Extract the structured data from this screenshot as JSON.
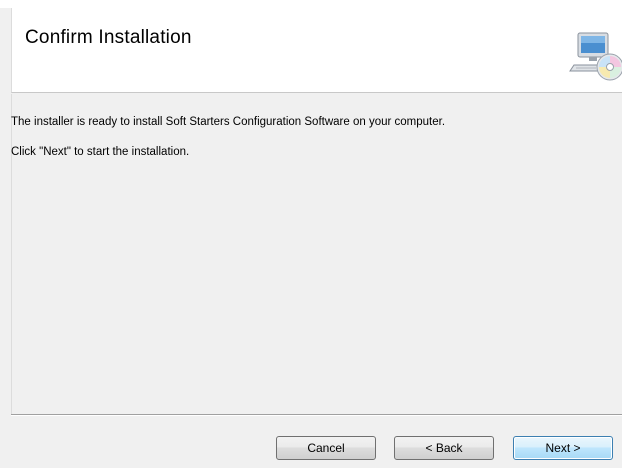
{
  "dialog": {
    "title": "Confirm Installation",
    "icon": "computer-cd-install-icon"
  },
  "content": {
    "line1": "The installer is ready to install Soft Starters Configuration Software on your computer.",
    "line2": "Click \"Next\" to start the installation."
  },
  "buttons": {
    "cancel": "Cancel",
    "back": "< Back",
    "next": "Next >"
  },
  "colors": {
    "panel_bg": "#f0f0f0",
    "header_bg": "#ffffff",
    "default_button_border": "#3c7fb1"
  }
}
